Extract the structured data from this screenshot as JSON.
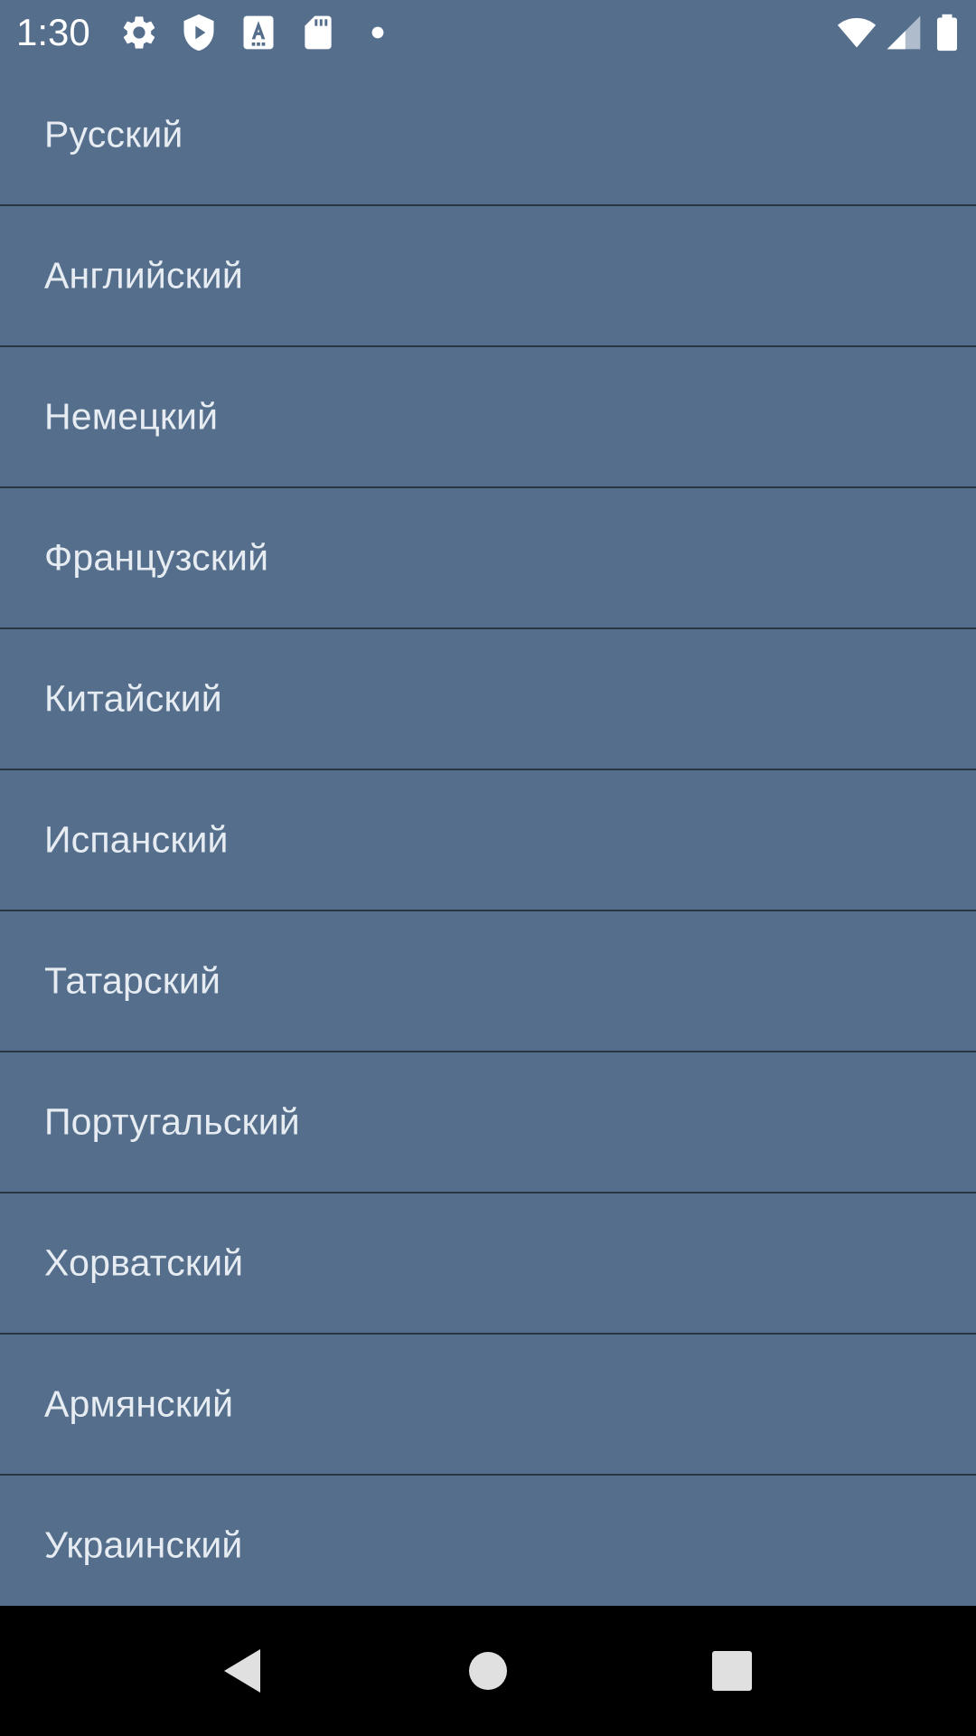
{
  "status_bar": {
    "time": "1:30",
    "icons": [
      "gear-icon",
      "shield-play-icon",
      "keyboard-a-icon",
      "sd-card-icon",
      "notification-dot-icon",
      "wifi-icon",
      "cell-signal-icon",
      "battery-icon"
    ],
    "color": "#FFFFFF"
  },
  "languages": [
    {
      "label": "Русский"
    },
    {
      "label": "Английский"
    },
    {
      "label": "Немецкий"
    },
    {
      "label": "Французский"
    },
    {
      "label": "Китайский"
    },
    {
      "label": "Испанский"
    },
    {
      "label": "Татарский"
    },
    {
      "label": "Португальский"
    },
    {
      "label": "Хорватский"
    },
    {
      "label": "Армянский"
    },
    {
      "label": "Украинский"
    }
  ],
  "navigation": {
    "buttons": [
      "back-icon",
      "home-icon",
      "recents-icon"
    ]
  },
  "colors": {
    "background": "#546E8B",
    "divider": "#2B3644",
    "text": "#E6ECF2",
    "nav_bar": "#000000"
  }
}
